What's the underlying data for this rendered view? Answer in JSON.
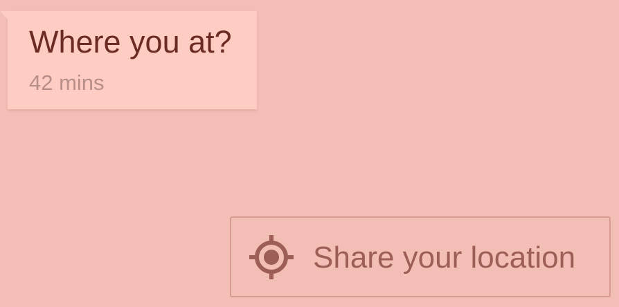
{
  "message": {
    "text": "Where you at?",
    "time": "42 mins"
  },
  "share_button": {
    "label": "Share your location",
    "icon": "location-target-icon"
  },
  "colors": {
    "background": "#f3beb6",
    "bubble": "#ffccc4",
    "message_text": "#6b2b24",
    "timestamp_text": "#b88e89",
    "button_border": "#d69a92",
    "button_content": "#9c5e57"
  }
}
